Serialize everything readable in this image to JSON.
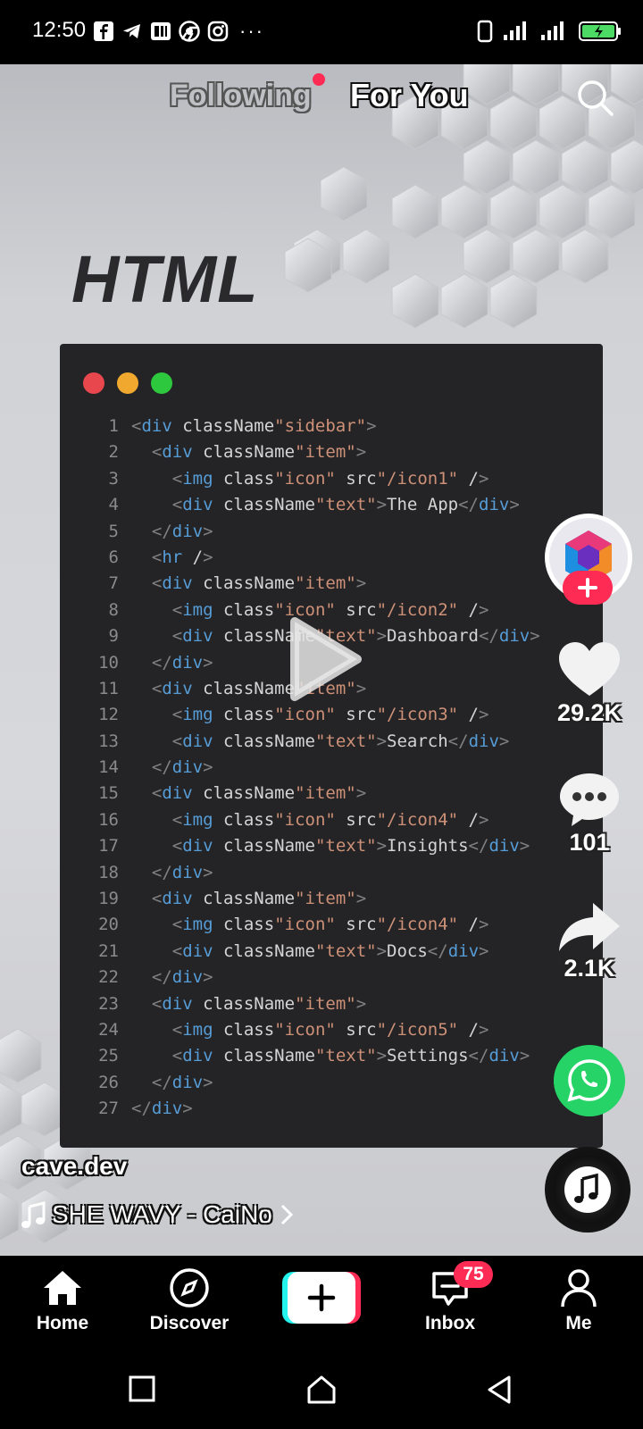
{
  "status_bar": {
    "time": "12:50",
    "left_icons": [
      "facebook-icon",
      "telegram-icon",
      "news-app-icon",
      "chrome-icon",
      "instagram-icon"
    ],
    "overflow": "···",
    "right_icons": [
      "vibrate-icon",
      "signal-icon",
      "signal-icon",
      "battery-charging-icon"
    ]
  },
  "top_tabs": {
    "following": "Following",
    "for_you": "For You"
  },
  "video": {
    "title_overlay": "HTML",
    "code_lines": [
      {
        "n": "1",
        "text": "<div className=\"sidebar\">"
      },
      {
        "n": "2",
        "text": "  <div className=\"item\">"
      },
      {
        "n": "3",
        "text": "    <img class=\"icon\" src=\"/icon1\" />"
      },
      {
        "n": "4",
        "text": "    <div className=\"text\">The App</div>"
      },
      {
        "n": "5",
        "text": "  </div>"
      },
      {
        "n": "6",
        "text": "  <hr />"
      },
      {
        "n": "7",
        "text": "  <div className=\"item\">"
      },
      {
        "n": "8",
        "text": "    <img class=\"icon\" src=\"/icon2\" />"
      },
      {
        "n": "9",
        "text": "    <div className=\"text\">Dashboard</div>"
      },
      {
        "n": "10",
        "text": "  </div>"
      },
      {
        "n": "11",
        "text": "  <div className=\"item\">"
      },
      {
        "n": "12",
        "text": "    <img class=\"icon\" src=\"/icon3\" />"
      },
      {
        "n": "13",
        "text": "    <div className=\"text\">Search</div>"
      },
      {
        "n": "14",
        "text": "  </div>"
      },
      {
        "n": "15",
        "text": "  <div className=\"item\">"
      },
      {
        "n": "16",
        "text": "    <img class=\"icon\" src=\"/icon4\" />"
      },
      {
        "n": "17",
        "text": "    <div className=\"text\">Insights</div>"
      },
      {
        "n": "18",
        "text": "  </div>"
      },
      {
        "n": "19",
        "text": "  <div className=\"item\">"
      },
      {
        "n": "20",
        "text": "    <img class=\"icon\" src=\"/icon4\" />"
      },
      {
        "n": "21",
        "text": "    <div className=\"text\">Docs</div>"
      },
      {
        "n": "22",
        "text": "  </div>"
      },
      {
        "n": "23",
        "text": "  <div className=\"item\">"
      },
      {
        "n": "24",
        "text": "    <img class=\"icon\" src=\"/icon5\" />"
      },
      {
        "n": "25",
        "text": "    <div className=\"text\">Settings</div>"
      },
      {
        "n": "26",
        "text": "  </div>"
      },
      {
        "n": "27",
        "text": "</div>"
      }
    ]
  },
  "actions": {
    "likes": "29.2K",
    "comments": "101",
    "shares": "2.1K"
  },
  "caption": {
    "username": "cave.dev",
    "music": "SHE WAVY - CaiNo"
  },
  "bottom_nav": {
    "home": "Home",
    "discover": "Discover",
    "inbox": "Inbox",
    "inbox_badge": "75",
    "me": "Me"
  },
  "colors": {
    "accent": "#fe2c55",
    "whatsapp": "#25d366",
    "code_bg": "#242426",
    "tag": "#569cd6",
    "attr": "#9cdcfe",
    "string": "#ce9178",
    "punct": "#808080"
  }
}
